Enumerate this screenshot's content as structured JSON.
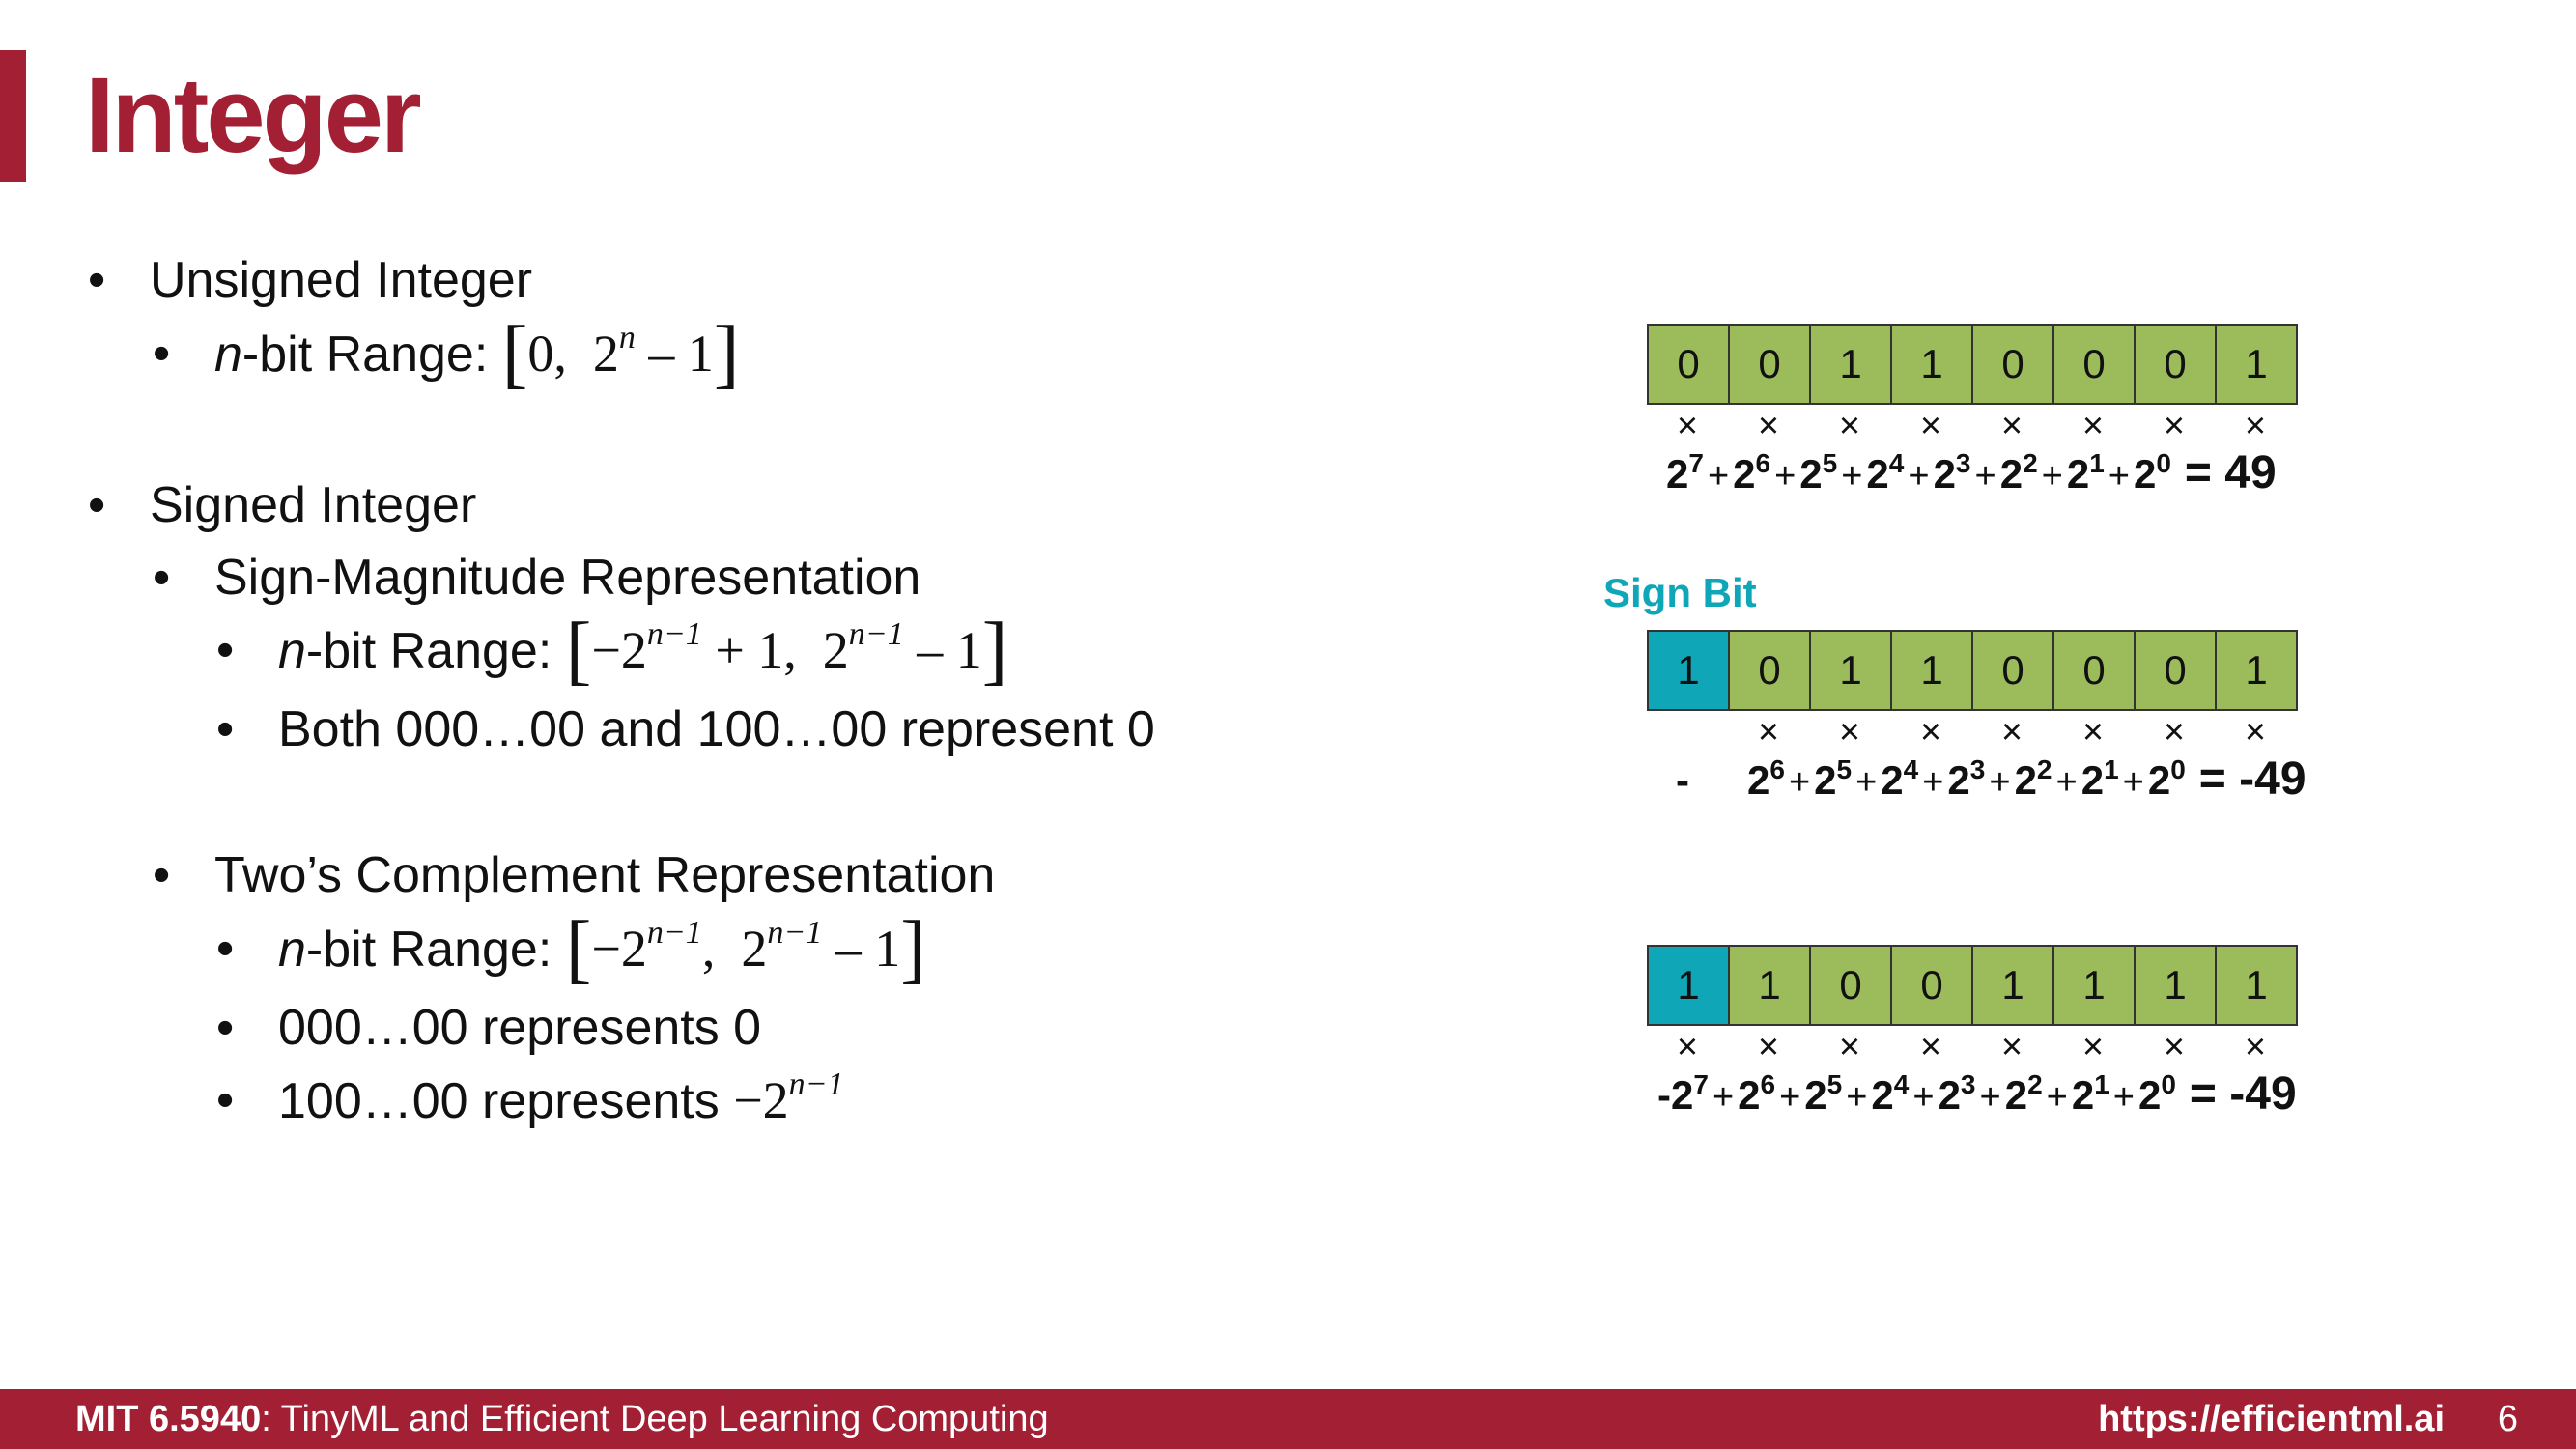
{
  "title": "Integer",
  "left": {
    "unsigned": {
      "heading": "Unsigned Integer",
      "range_n": "n",
      "range_label": "-bit Range:",
      "range_math": {
        "lo": "0,",
        "base": "2",
        "exp": "n",
        "rest": "– 1"
      }
    },
    "signed": {
      "heading": "Signed Integer",
      "sign_magnitude": {
        "heading": "Sign-Magnitude Representation",
        "range_n": "n",
        "range_label": "-bit Range:",
        "range_math": {
          "lo_base": "−2",
          "lo_exp": "n−1",
          "lo_rest": "+ 1,",
          "hi_base": "2",
          "hi_exp": "n−1",
          "hi_rest": "– 1"
        },
        "note": "Both 000…00 and 100…00 represent 0"
      },
      "twos_complement": {
        "heading": "Two’s Complement Representation",
        "range_n": "n",
        "range_label": "-bit Range:",
        "range_math": {
          "lo_base": "−2",
          "lo_exp": "n−1",
          "lo_rest": ",",
          "hi_base": "2",
          "hi_exp": "n−1",
          "hi_rest": "– 1"
        },
        "note_zero": "000…00 represents 0",
        "note_min_text": "100…00 represents",
        "note_min_base": "−2",
        "note_min_exp": "n−1"
      }
    }
  },
  "right": {
    "sign_bit_label": "Sign Bit",
    "times_symbol": "×",
    "plus_symbol": "+",
    "examples": [
      {
        "bits": [
          "0",
          "0",
          "1",
          "1",
          "0",
          "0",
          "0",
          "1"
        ],
        "sign_first": false,
        "times_count": 8,
        "prefix": "",
        "first_term_prefix": "",
        "terms": [
          "7",
          "6",
          "5",
          "4",
          "3",
          "2",
          "1",
          "0"
        ],
        "result": "= 49"
      },
      {
        "bits": [
          "1",
          "0",
          "1",
          "1",
          "0",
          "0",
          "0",
          "1"
        ],
        "sign_first": true,
        "times_count": 7,
        "prefix": "-",
        "first_term_prefix": "",
        "terms": [
          "6",
          "5",
          "4",
          "3",
          "2",
          "1",
          "0"
        ],
        "result": "= -49"
      },
      {
        "bits": [
          "1",
          "1",
          "0",
          "0",
          "1",
          "1",
          "1",
          "1"
        ],
        "sign_first": true,
        "times_count": 8,
        "prefix": "",
        "first_term_prefix": "-",
        "terms": [
          "7",
          "6",
          "5",
          "4",
          "3",
          "2",
          "1",
          "0"
        ],
        "result": "= -49"
      }
    ]
  },
  "footer": {
    "course_code": "MIT 6.5940",
    "course_name": ": TinyML and Efficient Deep Learning Computing",
    "url": "https://efficientml.ai",
    "page": "6"
  },
  "colors": {
    "accent": "#a31f34",
    "bit_green": "#9cbc5c",
    "sign_teal": "#0fa6b7"
  }
}
